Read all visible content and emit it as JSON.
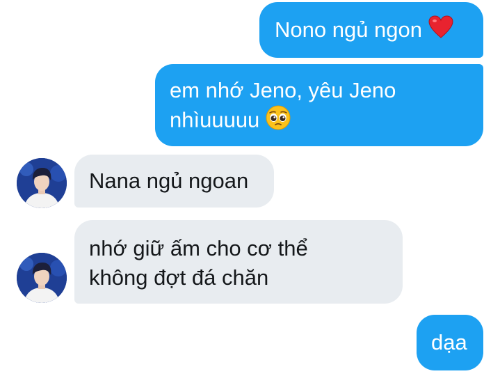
{
  "messages": [
    {
      "sender": "me",
      "text": "Nono ngủ ngon",
      "emoji": "red-heart"
    },
    {
      "sender": "me",
      "text": "em nhớ Jeno, yêu Jeno\nnhìuuuuu",
      "emoji": "pleading-face"
    },
    {
      "sender": "them",
      "text": "Nana ngủ ngoan"
    },
    {
      "sender": "them",
      "text": "nhớ giữ ấm cho cơ thể\nkhông đợt đá chăn"
    },
    {
      "sender": "me",
      "text": "dạa"
    }
  ],
  "colors": {
    "outgoing_bubble": "#1da1f2",
    "incoming_bubble": "#e8ecf0",
    "outgoing_text": "#ffffff",
    "incoming_text": "#14171a"
  },
  "icons": {
    "avatar": "contact-avatar"
  }
}
